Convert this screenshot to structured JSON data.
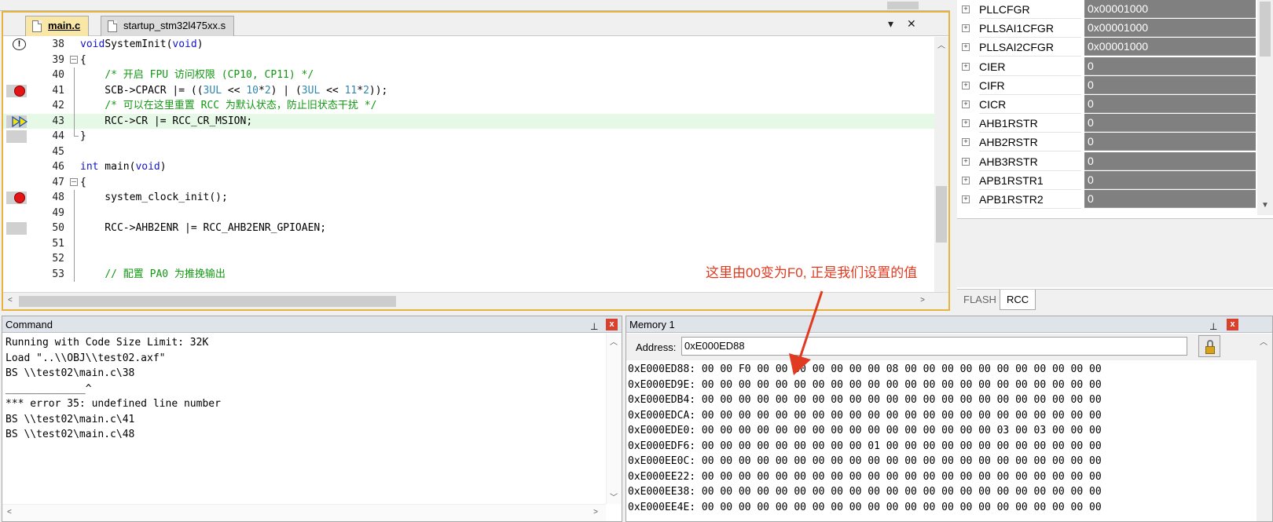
{
  "editor": {
    "tabs": [
      {
        "label": "main.c",
        "active": true
      },
      {
        "label": "startup_stm32l475xx.s",
        "active": false
      }
    ],
    "lines": [
      {
        "no": "38",
        "marker": "warning",
        "fold": "",
        "code": [
          [
            "kw",
            "void"
          ],
          [
            "",
            "SystemInit("
          ],
          [
            "kw",
            "void"
          ],
          [
            "",
            ")"
          ]
        ]
      },
      {
        "no": "39",
        "marker": "",
        "fold": "open",
        "code": [
          [
            "",
            "{"
          ]
        ]
      },
      {
        "no": "40",
        "marker": "",
        "fold": "line",
        "code": [
          [
            "",
            "    "
          ],
          [
            "cmt",
            "/* 开启 FPU 访问权限 (CP10, CP11) */"
          ]
        ]
      },
      {
        "no": "41",
        "marker": "breakpoint",
        "fold": "line",
        "code": [
          [
            "",
            "    SCB->CPACR |= (("
          ],
          [
            "num",
            "3UL"
          ],
          [
            "",
            " << "
          ],
          [
            "num",
            "10"
          ],
          [
            "",
            "*"
          ],
          [
            "num",
            "2"
          ],
          [
            "",
            ") | ("
          ],
          [
            "num",
            "3UL"
          ],
          [
            "",
            " << "
          ],
          [
            "num",
            "11"
          ],
          [
            "",
            "*"
          ],
          [
            "num",
            "2"
          ],
          [
            "",
            "));"
          ]
        ]
      },
      {
        "no": "42",
        "marker": "",
        "fold": "line",
        "code": [
          [
            "",
            "    "
          ],
          [
            "cmt",
            "/* 可以在这里重置 RCC 为默认状态，防止旧状态干扰 */"
          ]
        ]
      },
      {
        "no": "43",
        "marker": "current",
        "fold": "line",
        "code": [
          [
            "",
            "    RCC->CR |= RCC_CR_MSION;"
          ]
        ]
      },
      {
        "no": "44",
        "marker": "gray",
        "fold": "end",
        "code": [
          [
            "",
            "}"
          ]
        ]
      },
      {
        "no": "45",
        "marker": "",
        "fold": "",
        "code": []
      },
      {
        "no": "46",
        "marker": "",
        "fold": "",
        "code": [
          [
            "kw",
            "int"
          ],
          [
            "",
            " main("
          ],
          [
            "kw",
            "void"
          ],
          [
            "",
            ")"
          ]
        ]
      },
      {
        "no": "47",
        "marker": "",
        "fold": "open",
        "code": [
          [
            "",
            "{"
          ]
        ]
      },
      {
        "no": "48",
        "marker": "breakpoint",
        "fold": "line",
        "code": [
          [
            "",
            "    system_clock_init();"
          ]
        ]
      },
      {
        "no": "49",
        "marker": "",
        "fold": "line",
        "code": []
      },
      {
        "no": "50",
        "marker": "gray",
        "fold": "line",
        "code": [
          [
            "",
            "    RCC->AHB2ENR |= RCC_AHB2ENR_GPIOAEN;"
          ]
        ]
      },
      {
        "no": "51",
        "marker": "",
        "fold": "line",
        "code": []
      },
      {
        "no": "52",
        "marker": "",
        "fold": "line",
        "code": []
      },
      {
        "no": "53",
        "marker": "",
        "fold": "line",
        "code": [
          [
            "",
            "    "
          ],
          [
            "cmt",
            "// 配置 PA0 为推挽输出"
          ]
        ]
      }
    ],
    "tab_dropdown_glyph": "▾",
    "tab_close_glyph": "✕",
    "scroll_up_glyph": "︿",
    "scroll_down_glyph": "﹀",
    "scroll_left_glyph": "<",
    "scroll_right_glyph": ">"
  },
  "registers": {
    "rows": [
      {
        "name": "PLLCFGR",
        "value": "0x00001000"
      },
      {
        "name": "PLLSAI1CFGR",
        "value": "0x00001000"
      },
      {
        "name": "PLLSAI2CFGR",
        "value": "0x00001000"
      },
      {
        "name": "CIER",
        "value": "0"
      },
      {
        "name": "CIFR",
        "value": "0"
      },
      {
        "name": "CICR",
        "value": "0"
      },
      {
        "name": "AHB1RSTR",
        "value": "0"
      },
      {
        "name": "AHB2RSTR",
        "value": "0"
      },
      {
        "name": "AHB3RSTR",
        "value": "0"
      },
      {
        "name": "APB1RSTR1",
        "value": "0"
      },
      {
        "name": "APB1RSTR2",
        "value": "0"
      }
    ],
    "expand_glyph": "+",
    "tabs": [
      {
        "label": "FLASH",
        "active": false
      },
      {
        "label": "RCC",
        "active": true
      }
    ]
  },
  "command": {
    "title": "Command",
    "pin_glyph": "📌",
    "close_glyph": "x",
    "output": "Running with Code Size Limit: 32K\nLoad \"..\\\\OBJ\\\\test02.axf\"\nBS \\\\test02\\main.c\\38\n_____________^\n*** error 35: undefined line number\nBS \\\\test02\\main.c\\41\nBS \\\\test02\\main.c\\48"
  },
  "memory": {
    "title": "Memory 1",
    "address_label": "Address:",
    "address_value": "0xE000ED88",
    "dump": "0xE000ED88: 00 00 F0 00 00 00 00 00 00 00 08 00 00 00 00 00 00 00 00 00 00 00\n0xE000ED9E: 00 00 00 00 00 00 00 00 00 00 00 00 00 00 00 00 00 00 00 00 00 00\n0xE000EDB4: 00 00 00 00 00 00 00 00 00 00 00 00 00 00 00 00 00 00 00 00 00 00\n0xE000EDCA: 00 00 00 00 00 00 00 00 00 00 00 00 00 00 00 00 00 00 00 00 00 00\n0xE000EDE0: 00 00 00 00 00 00 00 00 00 00 00 00 00 00 00 00 03 00 03 00 00 00\n0xE000EDF6: 00 00 00 00 00 00 00 00 00 01 00 00 00 00 00 00 00 00 00 00 00 00\n0xE000EE0C: 00 00 00 00 00 00 00 00 00 00 00 00 00 00 00 00 00 00 00 00 00 00\n0xE000EE22: 00 00 00 00 00 00 00 00 00 00 00 00 00 00 00 00 00 00 00 00 00 00\n0xE000EE38: 00 00 00 00 00 00 00 00 00 00 00 00 00 00 00 00 00 00 00 00 00 00\n0xE000EE4E: 00 00 00 00 00 00 00 00 00 00 00 00 00 00 00 00 00 00 00 00 00 00"
  },
  "annotation": {
    "text": "这里由00变为F0, 正是我们设置的值",
    "color": "#e03a20"
  }
}
